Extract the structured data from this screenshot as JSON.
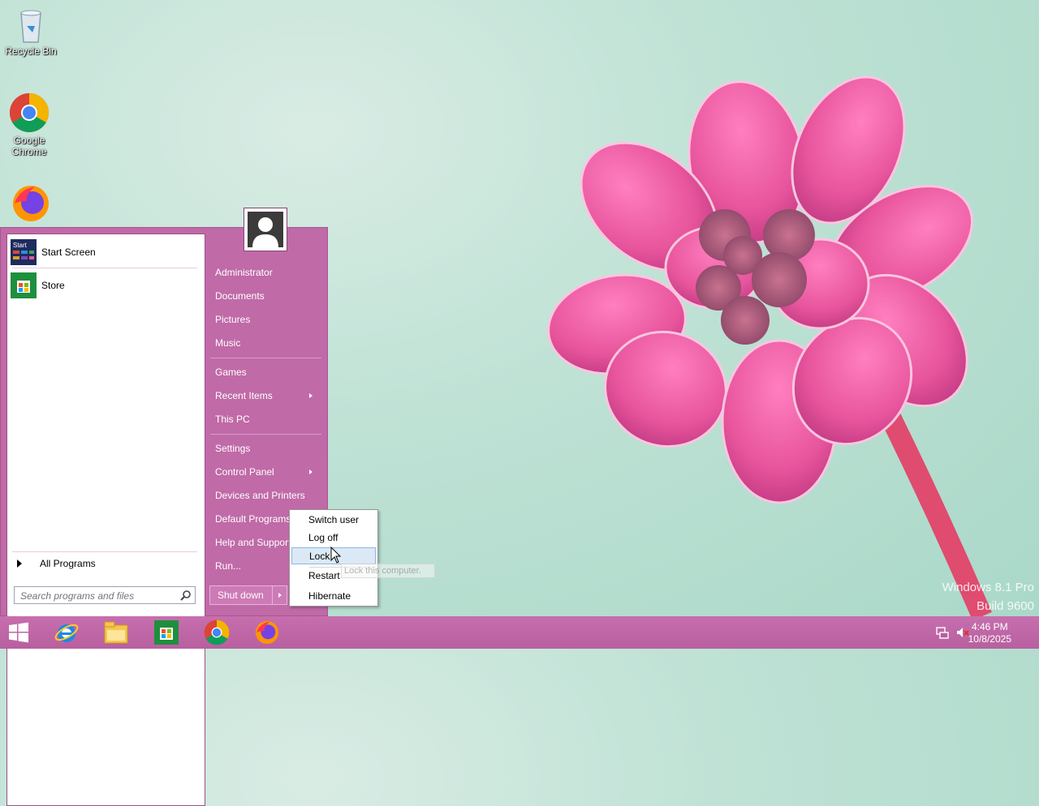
{
  "desktop": {
    "icons": [
      {
        "label": "Recycle Bin",
        "icon": "recycle-bin-icon"
      },
      {
        "label": "Google Chrome",
        "icon": "chrome-icon"
      },
      {
        "label": "Firefox",
        "icon": "firefox-icon"
      }
    ],
    "watermark": {
      "line1": "Windows 8.1 Pro",
      "line2": "Build 9600"
    }
  },
  "start_menu": {
    "pinned": [
      {
        "label": "Start Screen",
        "icon": "start-screen-icon"
      },
      {
        "label": "Store",
        "icon": "store-icon"
      }
    ],
    "all_programs": "All Programs",
    "search_placeholder": "Search programs and files",
    "right": {
      "user": "Administrator",
      "documents": "Documents",
      "pictures": "Pictures",
      "music": "Music",
      "games": "Games",
      "recent_items": "Recent Items",
      "this_pc": "This PC",
      "settings": "Settings",
      "control_panel": "Control Panel",
      "devices_printers": "Devices and Printers",
      "default_programs": "Default Programs",
      "help_support": "Help and Support",
      "run": "Run..."
    },
    "shutdown_label": "Shut down"
  },
  "shutdown_submenu": {
    "items": [
      "Switch user",
      "Log off",
      "Lock",
      "Restart",
      "Hibernate"
    ],
    "active": "Lock",
    "tooltip": "Lock this computer."
  },
  "taskbar": {
    "pinned": [
      "start-button",
      "internet-explorer-icon",
      "file-explorer-icon",
      "store-icon",
      "chrome-icon",
      "firefox-icon"
    ],
    "time": "4:46 PM",
    "date": "10/8/2025",
    "colors": {
      "accent": "#c06aa8"
    }
  }
}
